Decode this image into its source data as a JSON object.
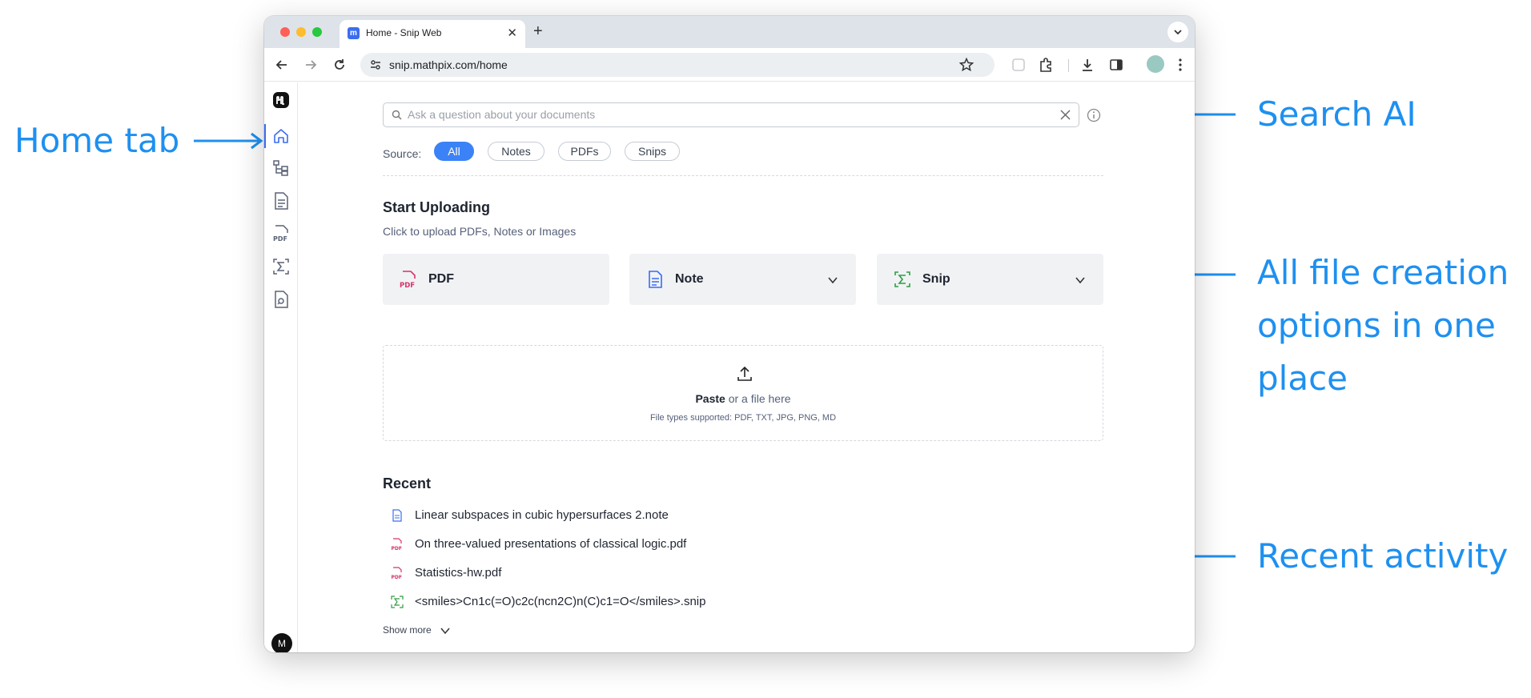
{
  "callouts": {
    "home_tab": "Home tab",
    "search_ai": "Search AI",
    "file_creation": [
      "All file creation",
      "options in one",
      "place"
    ],
    "recent_activity": "Recent activity"
  },
  "browser": {
    "tab_title": "Home - Snip Web",
    "url": "snip.mathpix.com/home"
  },
  "sidebar": {
    "items": [
      {
        "name": "home",
        "icon": "home-icon",
        "active": true
      },
      {
        "name": "folders",
        "icon": "folder-tree-icon"
      },
      {
        "name": "notes",
        "icon": "note-icon"
      },
      {
        "name": "pdfs",
        "icon": "pdf-icon"
      },
      {
        "name": "snips",
        "icon": "snip-icon"
      },
      {
        "name": "search-docs",
        "icon": "document-search-icon"
      }
    ],
    "avatar_initial": "M"
  },
  "search": {
    "placeholder": "Ask a question about your documents"
  },
  "source_filter": {
    "label": "Source:",
    "options": [
      "All",
      "Notes",
      "PDFs",
      "Snips"
    ],
    "selected": "All"
  },
  "upload": {
    "title": "Start Uploading",
    "subtitle": "Click to upload PDFs, Notes or Images",
    "cards": [
      {
        "label": "PDF",
        "icon": "pdf-icon",
        "has_dropdown": false
      },
      {
        "label": "Note",
        "icon": "note-icon",
        "has_dropdown": true
      },
      {
        "label": "Snip",
        "icon": "snip-icon",
        "has_dropdown": true
      }
    ],
    "drop_bold": "Paste",
    "drop_rest": " or a file here",
    "drop_types": "File types supported: PDF, TXT, JPG, PNG, MD"
  },
  "recent": {
    "title": "Recent",
    "items": [
      {
        "label": "Linear subspaces in cubic hypersurfaces 2.note",
        "icon": "note-icon"
      },
      {
        "label": "On three-valued presentations of classical logic.pdf",
        "icon": "pdf-icon"
      },
      {
        "label": "Statistics-hw.pdf",
        "icon": "pdf-icon"
      },
      {
        "label": "<smiles>Cn1c(=O)c2c(ncn2C)n(C)c1=O</smiles>.snip",
        "icon": "snip-icon"
      }
    ],
    "show_more": "Show more"
  },
  "colors": {
    "callout": "#1e90f0",
    "accent": "#3b82f6",
    "pdf": "#d6336c",
    "note": "#3a6df0",
    "snip": "#2f9e44"
  }
}
